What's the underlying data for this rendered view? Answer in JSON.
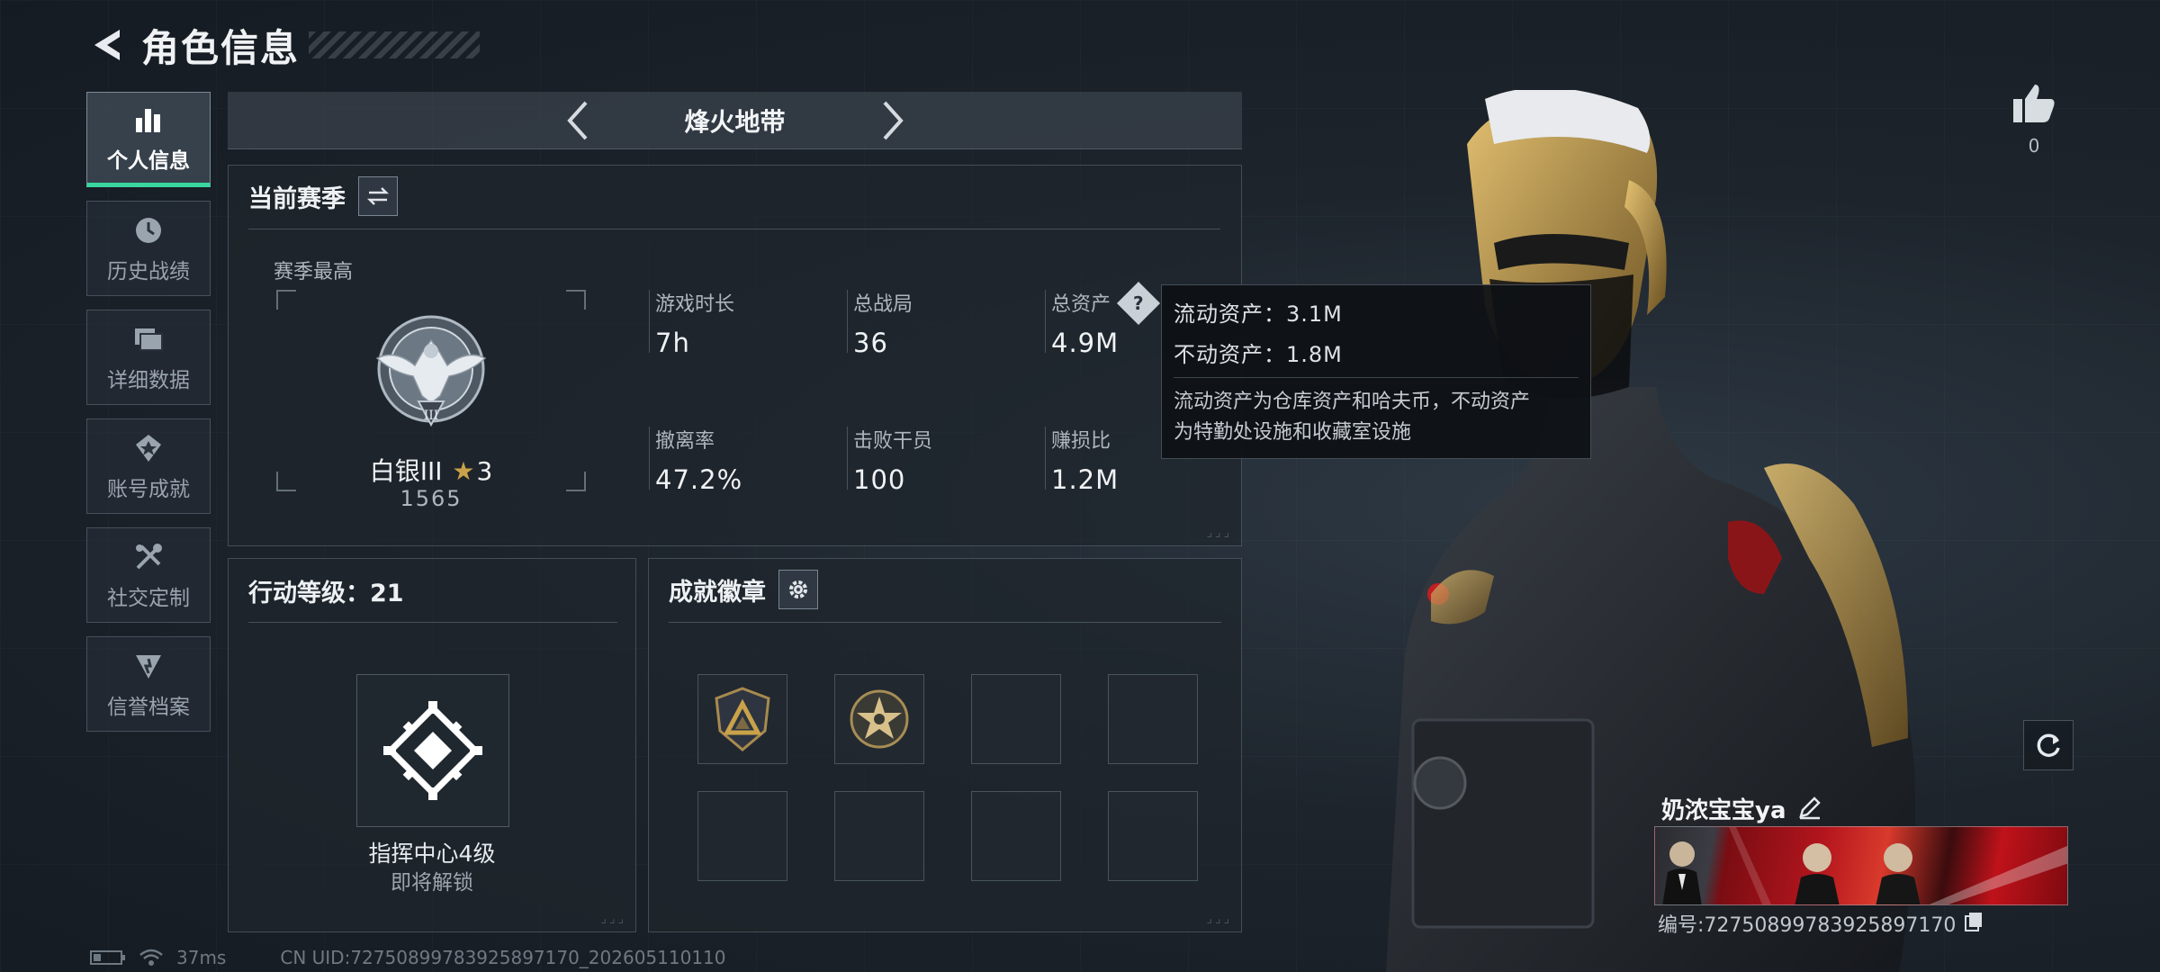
{
  "header": {
    "title": "角色信息"
  },
  "nav": {
    "items": [
      {
        "label": "个人信息",
        "icon": "bar-chart-icon",
        "active": true
      },
      {
        "label": "历史战绩",
        "icon": "history-clock-icon"
      },
      {
        "label": "详细数据",
        "icon": "folders-icon"
      },
      {
        "label": "账号成就",
        "icon": "achievement-icon"
      },
      {
        "label": "社交定制",
        "icon": "tools-icon"
      },
      {
        "label": "信誉档案",
        "icon": "reputation-icon"
      }
    ]
  },
  "mode": {
    "title": "烽火地带"
  },
  "season": {
    "title": "当前赛季",
    "subtitle": "赛季最高",
    "rank_name": "白银III",
    "rank_stars": "3",
    "rank_score": "1565",
    "stats": [
      {
        "label": "游戏时长",
        "value": "7h"
      },
      {
        "label": "总战局",
        "value": "36"
      },
      {
        "label": "总资产",
        "value": "4.9M"
      },
      {
        "label": "撤离率",
        "value": "47.2%"
      },
      {
        "label": "击败干员",
        "value": "100"
      },
      {
        "label": "赚损比",
        "value": "1.2M"
      }
    ]
  },
  "tooltip": {
    "liquid": "流动资产：3.1M",
    "fixed": "不动资产：1.8M",
    "desc_line1": "流动资产为仓库资产和哈夫币，不动资产",
    "desc_line2": "为特勤处设施和收藏室设施"
  },
  "action_level": {
    "title": "行动等级：21",
    "unlock_name": "指挥中心4级",
    "unlock_state": "即将解锁"
  },
  "achievements": {
    "title": "成就徽章"
  },
  "like": {
    "count": "0"
  },
  "profile": {
    "nickname": "奶浓宝宝ya",
    "id_line": "编号:72750899783925897170"
  },
  "status": {
    "ping": "37ms",
    "uid": "CN UID:72750899783925897170_202605110110"
  },
  "colors": {
    "accent": "#3ad6a0",
    "gold": "#c9a24a",
    "tooltip_bg": "#0e1115"
  }
}
